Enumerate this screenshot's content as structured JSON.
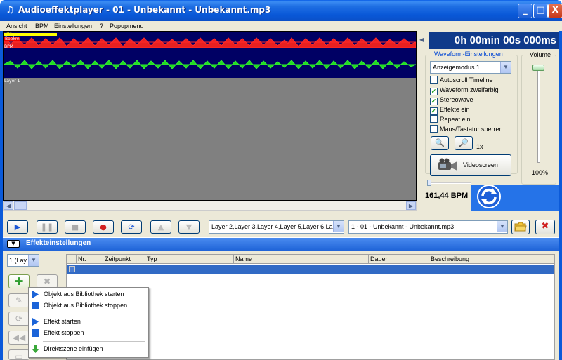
{
  "window": {
    "title": "Audioeffektplayer - 01 - Unbekannt - Unbekannt.mp3",
    "minimize": "_",
    "maximize": "□",
    "close": "X"
  },
  "menu": [
    "Ansicht",
    "BPM",
    "Einstellungen",
    "?",
    "Popupmenu"
  ],
  "waveform": {
    "time_label": "30s",
    "red_label": "Bookm",
    "blue_label": "BPM",
    "layer_label": "Layer 1"
  },
  "right_panel": {
    "time_display": "0h 00min 00s 000ms",
    "group_title": "Waveform-Einstellungen",
    "mode_select": "Anzeigemodus 1",
    "checkboxes": [
      {
        "label": "Autoscroll Timeline",
        "checked": false
      },
      {
        "label": "Waveform zweifarbig",
        "checked": true
      },
      {
        "label": "Stereowave",
        "checked": true
      },
      {
        "label": "Effekte ein",
        "checked": true
      },
      {
        "label": "Repeat ein",
        "checked": false
      },
      {
        "label": "Maus/Tastatur sperren",
        "checked": false
      }
    ],
    "zoom_label": "1x",
    "videoscreen_label": "Videoscreen",
    "volume_label": "Volume",
    "volume_value": "100%",
    "bpm_value": "161,44 BPM"
  },
  "transport": {
    "layer_select": "Layer 2,Layer 3,Layer 4,Layer 5,Layer 6,La",
    "file_select": "1 - 01 - Unbekannt - Unbekannt.mp3"
  },
  "effects": {
    "title": "Effekteinstellungen",
    "layer_num": "1 (Lay",
    "columns": [
      "",
      "Nr.",
      "Zeitpunkt",
      "Typ",
      "Name",
      "Dauer",
      "Beschreibung"
    ]
  },
  "popup": {
    "items": [
      {
        "label": "Objekt aus Bibliothek starten",
        "icon": "play-icon"
      },
      {
        "label": "Objekt aus Bibliothek stoppen",
        "icon": "stop-icon"
      },
      {
        "label": "Effekt starten",
        "icon": "play-icon"
      },
      {
        "label": "Effekt stoppen",
        "icon": "stop-icon"
      },
      {
        "label": "Direktszene einfügen",
        "icon": "insert-arrow-icon"
      }
    ]
  }
}
